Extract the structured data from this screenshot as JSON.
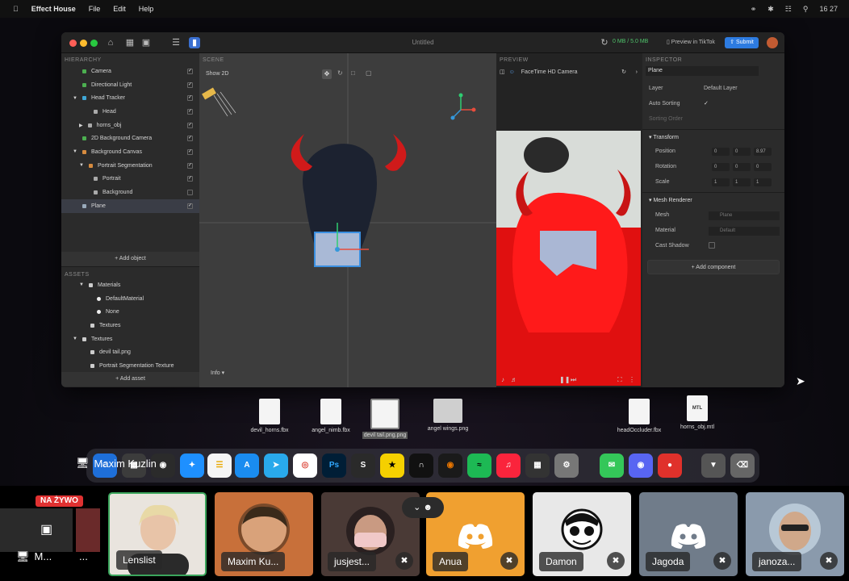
{
  "menubar": {
    "app": "Effect House",
    "items": [
      "File",
      "Edit",
      "Help"
    ],
    "clock": "16 27"
  },
  "window": {
    "title": "Untitled",
    "memory": "0 MB / 5.0 MB",
    "preview_label": "Preview in TikTok",
    "submit_label": "Submit"
  },
  "hierarchy": {
    "header": "HIERARCHY",
    "items": [
      "Camera",
      "Directional Light",
      "Head Tracker",
      "Head",
      "horns_obj",
      "2D Background Camera",
      "Background Canvas",
      "Portrait Segmentation",
      "Portrait",
      "Background",
      "Plane"
    ],
    "add_label": "+ Add object"
  },
  "assets": {
    "header": "ASSETS",
    "items": [
      "Materials",
      "DefaultMaterial",
      "None",
      "Textures",
      "Textures",
      "devil tail.png",
      "Portrait Segmentation Texture"
    ],
    "add_label": "+ Add asset"
  },
  "scene": {
    "header": "SCENE",
    "show2d": "Show 2D",
    "info": "Info"
  },
  "preview": {
    "header": "PREVIEW",
    "camera": "FaceTime HD Camera"
  },
  "inspector": {
    "header": "INSPECTOR",
    "object_name": "Plane",
    "layer_label": "Layer",
    "layer_value": "Default Layer",
    "auto_sorting": "Auto Sorting",
    "sorting_order": "Sorting Order",
    "transform": "Transform",
    "position": "Position",
    "rotation": "Rotation",
    "scale": "Scale",
    "pos_vals": [
      "0",
      "0",
      "8.97"
    ],
    "rot_vals": [
      "0",
      "0",
      "0"
    ],
    "scale_vals": [
      "1",
      "1",
      "1"
    ],
    "mesh_renderer": "Mesh Renderer",
    "mesh": "Mesh",
    "mesh_value": "Plane",
    "material": "Material",
    "material_value": "Default",
    "cast_shadow": "Cast Shadow",
    "add_component": "+ Add component"
  },
  "desktop_files": [
    "devil_horns.fbx",
    "angel_nimb.fbx",
    "devil tail.png.png",
    "angel wings.png",
    "headOccluder.fbx",
    "horns_obj.mtl"
  ],
  "screen_share": {
    "name": "Maxim Kuzlin"
  },
  "call": {
    "live_badge": "NA ŻYWO",
    "self_label": "M...",
    "more": "...",
    "participants": [
      "Lenslist",
      "Maxim Ku...",
      "jusjest...",
      "Anua",
      "Damon",
      "Jagoda",
      "janoza..."
    ]
  },
  "colors": {
    "accent": "#2d7be0",
    "speaking": "#3ba55c",
    "discord_orange": "#f0a030"
  }
}
